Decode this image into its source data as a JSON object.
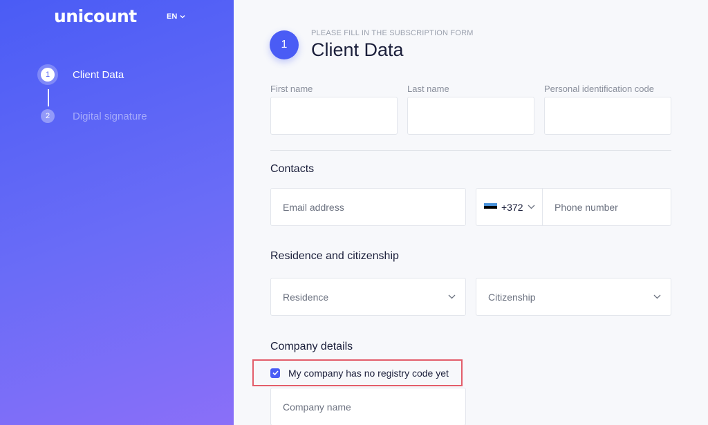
{
  "brand": {
    "logo": "unicount",
    "language": "EN"
  },
  "steps": [
    {
      "number": "1",
      "label": "Client Data"
    },
    {
      "number": "2",
      "label": "Digital signature"
    }
  ],
  "header": {
    "step_number": "1",
    "subtitle": "PLEASE FILL IN THE SUBSCRIPTION FORM",
    "title": "Client Data"
  },
  "personal": {
    "first_name_label": "First name",
    "last_name_label": "Last name",
    "personal_code_label": "Personal identification code"
  },
  "contacts": {
    "title": "Contacts",
    "email_placeholder": "Email address",
    "phone_code": "+372",
    "phone_placeholder": "Phone number"
  },
  "residence": {
    "title": "Residence and citizenship",
    "residence_placeholder": "Residence",
    "citizenship_placeholder": "Citizenship"
  },
  "company": {
    "title": "Company details",
    "no_registry_label": "My company has no registry code yet",
    "no_registry_checked": true,
    "company_name_placeholder": "Company name"
  },
  "colors": {
    "accent": "#4a5cf5",
    "highlight_border": "#e35d6a"
  },
  "icons": [
    "chevron-down-icon",
    "estonia-flag-icon",
    "checkmark-icon"
  ]
}
